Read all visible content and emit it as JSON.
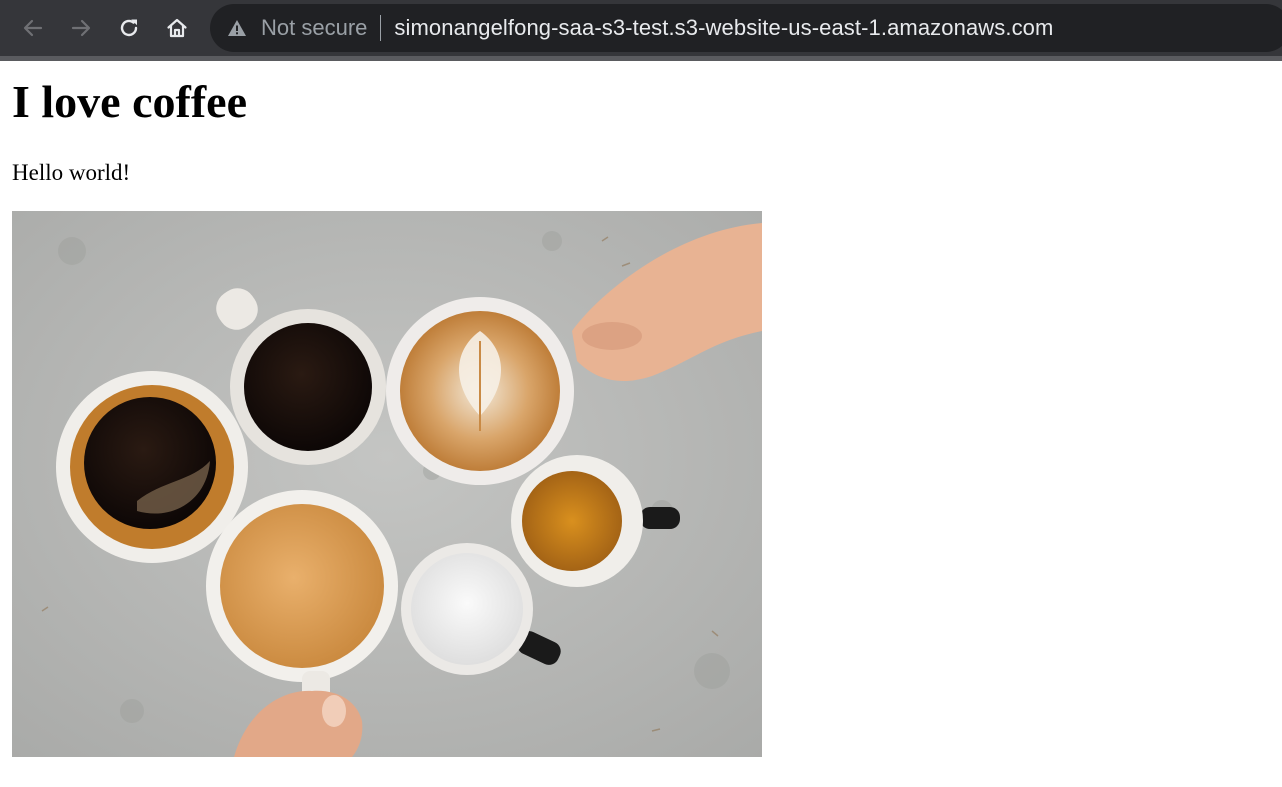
{
  "browser": {
    "security_label": "Not secure",
    "url": "simonangelfong-saa-s3-test.s3-website-us-east-1.amazonaws.com",
    "icons": [
      "back-arrow-icon",
      "forward-arrow-icon",
      "reload-icon",
      "home-icon",
      "warning-icon"
    ]
  },
  "page": {
    "heading": "I love coffee",
    "paragraph": "Hello world!",
    "image": {
      "alt": "Overhead view of seven coffee cups on a concrete table, two hands holding cups"
    }
  },
  "colors": {
    "toolbar": "#35363a",
    "omnibox": "#202124",
    "url_text": "#e8eaed",
    "secondary_text": "#9aa0a6",
    "table": "#b5b6b4"
  }
}
